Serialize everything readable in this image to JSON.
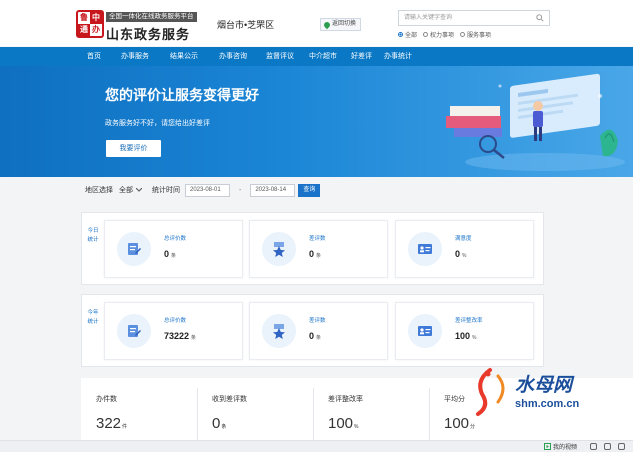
{
  "header": {
    "logo_chars": [
      "鲁",
      "中",
      "通",
      "办"
    ],
    "slogan": "全国一体化在线政务服务平台",
    "brand": "山东政务服务",
    "city": "烟台市•芝罘区",
    "switch_label": "返回切换",
    "search_placeholder": "请输入关键字查询",
    "radio_options": [
      "全部",
      "权力事项",
      "服务事项"
    ],
    "radio_selected": "全部"
  },
  "nav": {
    "items": [
      "首页",
      "办事服务",
      "结果公示",
      "办事咨询",
      "监督评议",
      "中介超市",
      "好差评",
      "办事统计"
    ]
  },
  "banner": {
    "title": "您的评价让服务变得更好",
    "subtitle": "政务服务好不好，请您给出好差评",
    "button": "我要评价"
  },
  "filter": {
    "area_label": "地区选择",
    "area_value": "全部",
    "time_label": "统计时间",
    "date_start": "2023-08-01",
    "separator": "-",
    "date_end": "2023-08-14",
    "query_button": "查询"
  },
  "today": {
    "label": "今日统计",
    "cards": [
      {
        "label": "总评价数",
        "value": "0",
        "unit": "条",
        "icon": "evaluation-edit-icon"
      },
      {
        "label": "差评数",
        "value": "0",
        "unit": "条",
        "icon": "star-badge-icon"
      },
      {
        "label": "满意度",
        "value": "0",
        "unit": "%",
        "icon": "id-card-icon"
      }
    ]
  },
  "year": {
    "label": "今年统计",
    "cards": [
      {
        "label": "总评价数",
        "value": "73222",
        "unit": "条",
        "icon": "evaluation-edit-icon"
      },
      {
        "label": "差评数",
        "value": "0",
        "unit": "条",
        "icon": "star-badge-icon"
      },
      {
        "label": "差评整改率",
        "value": "100",
        "unit": "%",
        "icon": "id-card-icon"
      }
    ]
  },
  "bottom": [
    {
      "label": "办件数",
      "value": "322",
      "unit": "件"
    },
    {
      "label": "收到差评数",
      "value": "0",
      "unit": "条"
    },
    {
      "label": "差评整改率",
      "value": "100",
      "unit": "%"
    },
    {
      "label": "平均分",
      "value": "100",
      "unit": "分"
    }
  ],
  "watermark": {
    "text": "水母网",
    "url": "shm.com.cn"
  },
  "statusbar": {
    "video_label": "我的视频"
  },
  "colors": {
    "primary": "#0a78c4",
    "accent": "#1a73c8",
    "logo_red": "#c8161d"
  }
}
